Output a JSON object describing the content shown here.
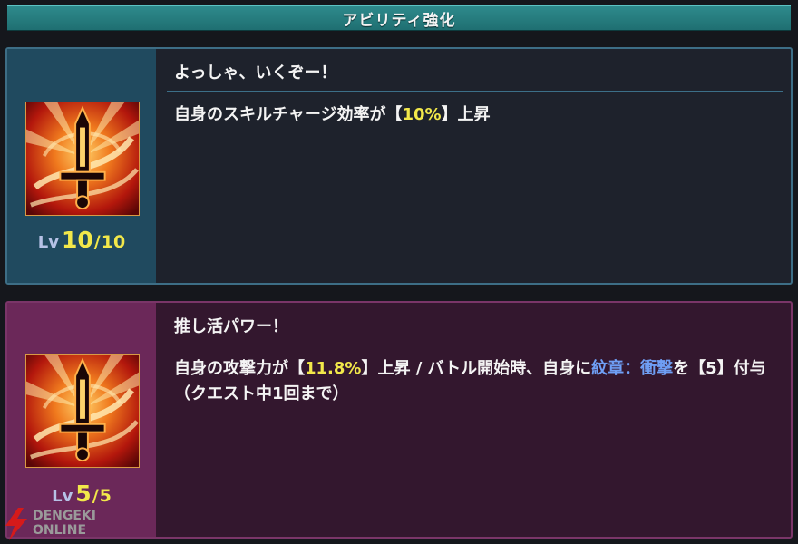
{
  "header": {
    "title": "アビリティ強化"
  },
  "abilities": [
    {
      "name": "よっしゃ、いくぞー！",
      "desc_segments": [
        "自身のスキルチャージ効率が【",
        "10%",
        "】上昇"
      ],
      "level": {
        "label": "Lv",
        "current": "10",
        "separator": "/",
        "max": "10"
      },
      "icon": "sword-icon"
    },
    {
      "name": "推し活パワー！",
      "desc_segments": [
        "自身の攻撃力が【",
        "11.8%",
        "】上昇 / バトル開始時、自身に",
        "紋章：衝撃",
        "を【5】付与（クエスト中1回まで）"
      ],
      "level": {
        "label": "Lv",
        "current": "5",
        "separator": "/",
        "max": "5"
      },
      "icon": "sword-icon"
    }
  ],
  "watermark": {
    "line1": "DENGEKI",
    "line2": "ONLINE"
  },
  "colors": {
    "highlight": "#f2e84a",
    "link_blue": "#6f9ff5",
    "header_teal": "#2a8487",
    "card1_side": "#204a5f",
    "card2_side": "#6b2859"
  }
}
